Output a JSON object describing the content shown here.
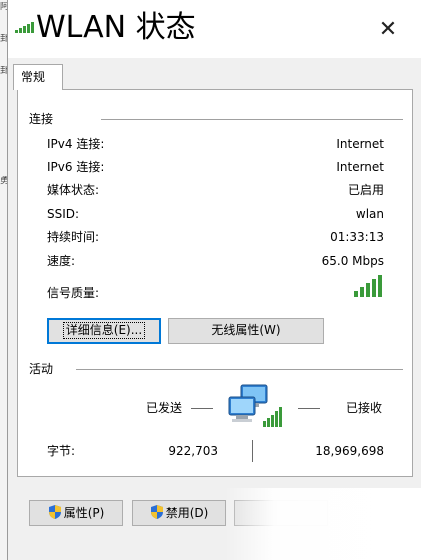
{
  "window": {
    "title": "WLAN 状态",
    "close_glyph": "✕"
  },
  "tabs": [
    {
      "label": "常规",
      "selected": true
    }
  ],
  "connection": {
    "group_label": "连接",
    "rows": [
      {
        "label": "IPv4 连接:",
        "value": "Internet"
      },
      {
        "label": "IPv6 连接:",
        "value": "Internet"
      },
      {
        "label": "媒体状态:",
        "value": "已启用"
      },
      {
        "label": "SSID:",
        "value": "wlan"
      },
      {
        "label": "持续时间:",
        "value": "01:33:13"
      },
      {
        "label": "速度:",
        "value": "65.0 Mbps"
      }
    ],
    "signal_label": "信号质量:",
    "signal_icon": "signal-bars-icon",
    "buttons": {
      "details": "详细信息(E)...",
      "wireless_props": "无线属性(W)"
    }
  },
  "activity": {
    "group_label": "活动",
    "sent_label": "已发送",
    "received_label": "已接收",
    "bytes_label": "字节:",
    "bytes_sent": "922,703",
    "bytes_received": "18,969,698",
    "network_icon": "network-computers-icon"
  },
  "bottom_buttons": {
    "properties": "属性(P)",
    "disable": "禁用(D)"
  },
  "colors": {
    "signal_green": "#3a9a3a",
    "default_button_border": "#0078d7",
    "window_bg": "#f0f0f0"
  }
}
